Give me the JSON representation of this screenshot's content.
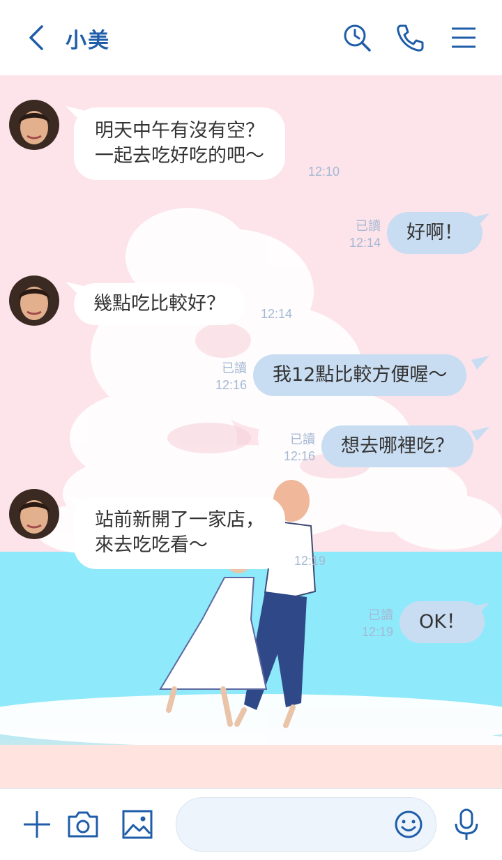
{
  "header": {
    "title": "小美"
  },
  "icons": {
    "back": "chevron-left-icon",
    "search": "search-icon",
    "call": "phone-icon",
    "menu": "menu-icon",
    "plus": "plus-icon",
    "camera": "camera-icon",
    "image": "image-icon",
    "emoji": "emoji-icon",
    "mic": "microphone-icon"
  },
  "colors": {
    "accent": "#1f5da8",
    "incoming_bubble": "#ffffff",
    "outgoing_bubble": "#c9ddf2",
    "meta_text": "#a5b9d4"
  },
  "messages": [
    {
      "side": "in",
      "lines": [
        "明天中午有沒有空？",
        "一起去吃好吃的吧～"
      ],
      "time": "12:10"
    },
    {
      "side": "out",
      "text": "好啊！",
      "read": "已讀",
      "time": "12:14"
    },
    {
      "side": "in",
      "lines": [
        "幾點吃比較好？"
      ],
      "time": "12:14"
    },
    {
      "side": "out",
      "text": "我12點比較方便喔～",
      "read": "已讀",
      "time": "12:16"
    },
    {
      "side": "out",
      "text": "想去哪裡吃？",
      "read": "已讀",
      "time": "12:16"
    },
    {
      "side": "in",
      "lines": [
        "站前新開了一家店，",
        "來去吃吃看～"
      ],
      "time": "12:19"
    },
    {
      "side": "out",
      "text": "OK！",
      "read": "已讀",
      "time": "12:19"
    }
  ],
  "composer": {
    "value": ""
  }
}
